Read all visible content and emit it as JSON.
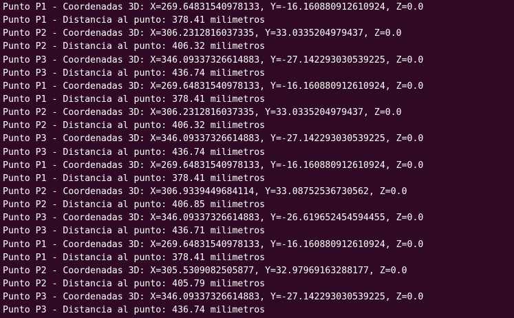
{
  "terminal": {
    "lines": [
      "Punto P1 - Coordenadas 3D: X=269.64831540978133, Y=-16.160880912610924, Z=0.0",
      "Punto P1 - Distancia al punto: 378.41 milimetros",
      "Punto P2 - Coordenadas 3D: X=306.2312816037335, Y=33.0335204979437, Z=0.0",
      "Punto P2 - Distancia al punto: 406.32 milimetros",
      "Punto P3 - Coordenadas 3D: X=346.09337326614883, Y=-27.142293030539225, Z=0.0",
      "Punto P3 - Distancia al punto: 436.74 milimetros",
      "Punto P1 - Coordenadas 3D: X=269.64831540978133, Y=-16.160880912610924, Z=0.0",
      "Punto P1 - Distancia al punto: 378.41 milimetros",
      "Punto P2 - Coordenadas 3D: X=306.2312816037335, Y=33.0335204979437, Z=0.0",
      "Punto P2 - Distancia al punto: 406.32 milimetros",
      "Punto P3 - Coordenadas 3D: X=346.09337326614883, Y=-27.142293030539225, Z=0.0",
      "Punto P3 - Distancia al punto: 436.74 milimetros",
      "Punto P1 - Coordenadas 3D: X=269.64831540978133, Y=-16.160880912610924, Z=0.0",
      "Punto P1 - Distancia al punto: 378.41 milimetros",
      "Punto P2 - Coordenadas 3D: X=306.9339449684114, Y=33.08752536730562, Z=0.0",
      "Punto P2 - Distancia al punto: 406.85 milimetros",
      "Punto P3 - Coordenadas 3D: X=346.09337326614883, Y=-26.619652454594455, Z=0.0",
      "Punto P3 - Distancia al punto: 436.71 milimetros",
      "Punto P1 - Coordenadas 3D: X=269.64831540978133, Y=-16.160880912610924, Z=0.0",
      "Punto P1 - Distancia al punto: 378.41 milimetros",
      "Punto P2 - Coordenadas 3D: X=305.5309082505877, Y=32.97969163288177, Z=0.0",
      "Punto P2 - Distancia al punto: 405.79 milimetros",
      "Punto P3 - Coordenadas 3D: X=346.09337326614883, Y=-27.142293030539225, Z=0.0",
      "Punto P3 - Distancia al punto: 436.74 milimetros"
    ]
  }
}
